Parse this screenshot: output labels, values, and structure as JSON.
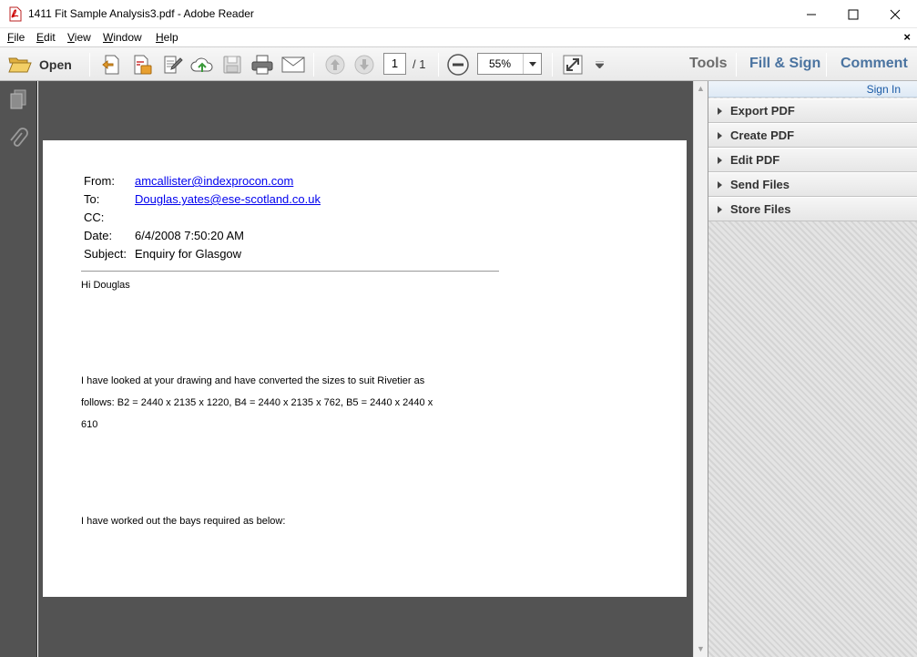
{
  "window": {
    "title": "1411 Fit Sample Analysis3.pdf - Adobe Reader"
  },
  "menu": {
    "items": [
      {
        "key": "F",
        "rest": "ile"
      },
      {
        "key": "E",
        "rest": "dit"
      },
      {
        "key": "V",
        "rest": "iew"
      },
      {
        "key": "W",
        "rest": "indow"
      },
      {
        "key": "H",
        "rest": "elp"
      }
    ],
    "close_glyph": "×"
  },
  "toolbar": {
    "open_label": "Open",
    "current_page": "1",
    "page_total": "/ 1",
    "zoom": "55%",
    "tools_label": "Tools",
    "fill_sign_label": "Fill & Sign",
    "comment_label": "Comment"
  },
  "email": {
    "labels": {
      "from": "From:",
      "to": "To:",
      "cc": "CC:",
      "date": "Date:",
      "subject": "Subject:"
    },
    "from": "amcallister@indexprocon.com",
    "to": "Douglas.yates@ese-scotland.co.uk",
    "cc": "",
    "date": "6/4/2008 7:50:20 AM",
    "subject": "Enquiry for Glasgow",
    "body": [
      "Hi Douglas",
      "I have looked at your drawing and have converted the sizes to suit Rivetier as",
      "follows:  B2 = 2440 x 2135 x 1220, B4 = 2440 x 2135 x 762, B5 = 2440 x 2440 x",
      "610",
      "I have worked out the bays required as below:"
    ]
  },
  "right_pane": {
    "sign_in": "Sign In",
    "panels": [
      "Export PDF",
      "Create PDF",
      "Edit PDF",
      "Send Files",
      "Store Files"
    ]
  }
}
